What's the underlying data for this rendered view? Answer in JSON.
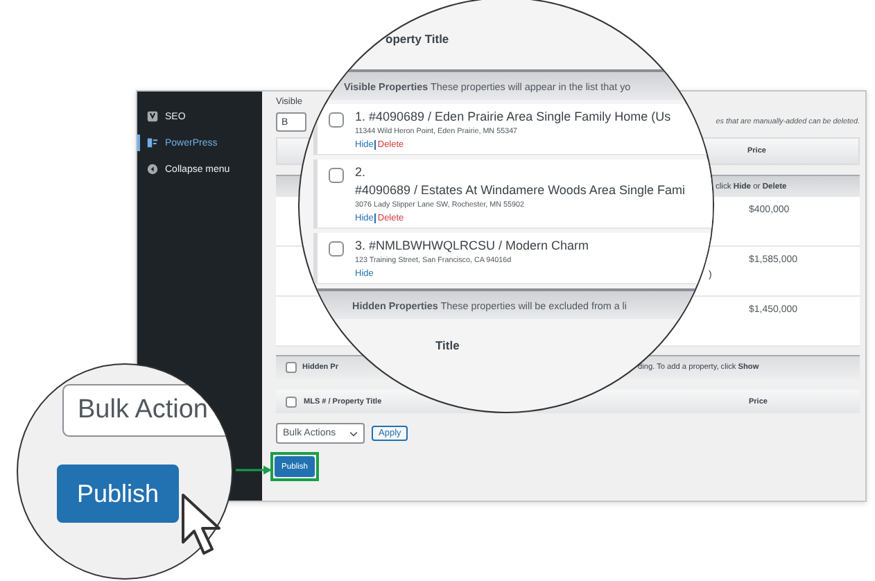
{
  "sidebar": {
    "items": [
      {
        "label": "SEO",
        "kind": "seo",
        "selected": false
      },
      {
        "label": "PowerPress",
        "kind": "podcast",
        "selected": true
      },
      {
        "label": "Collapse menu",
        "kind": "collapse",
        "selected": false
      }
    ]
  },
  "main": {
    "visible_label": "Visible",
    "bulk_select_top": "B",
    "notice": "es that are manually-added can be deleted.",
    "table_header": {
      "price": "Price"
    },
    "visible_section_tail": "click **Hide** or **Delete**",
    "rows": [
      {
        "price": "$400,000",
        "fragment": ""
      },
      {
        "price": "$1,585,000",
        "fragment": ")"
      },
      {
        "price": "$1,450,000",
        "fragment": ""
      }
    ],
    "hidden_section": {
      "checked": false,
      "head": "Hidden Pr",
      "tail": "ding. To add a property, click **Show**"
    },
    "footer_header": {
      "checked": false,
      "title": "MLS # / Property Title",
      "price": "Price"
    },
    "bulk_actions": {
      "value": "Bulk Actions",
      "apply": "Apply"
    },
    "publish": "Publish"
  },
  "magnifier": {
    "header": "operty Title",
    "visible_section": "**Visible Properties** These properties will appear in the list that yo",
    "properties": [
      {
        "number": "1.",
        "title": "#4090689 / Eden Prairie Area Single Family Home (Us",
        "wrapped": false,
        "address": "11344 Wild Heron Point, Eden Prairie, MN 55347",
        "checked": false,
        "actions": [
          {
            "label": "Hide",
            "kind": "hide"
          },
          {
            "label": "Delete",
            "kind": "delete"
          }
        ]
      },
      {
        "number": "2.",
        "title": "#4090689 / Estates At Windamere Woods Area Single Fami",
        "wrapped": true,
        "address": "3076 Lady Slipper Lane SW, Rochester, MN 55902",
        "checked": false,
        "actions": [
          {
            "label": "Hide",
            "kind": "hide"
          },
          {
            "label": "Delete",
            "kind": "delete"
          }
        ]
      },
      {
        "number": "3.",
        "title": "#NMLBWHWQLRCSU / Modern Charm",
        "wrapped": false,
        "address": "123 Training Street, San Francisco, CA 94016d",
        "checked": false,
        "actions": [
          {
            "label": "Hide",
            "kind": "hide"
          }
        ]
      }
    ],
    "hidden_section": "**Hidden Properties** These properties will be excluded from a li",
    "footer": "Title"
  },
  "callout": {
    "bulk_actions": "Bulk Action",
    "publish": "Publish"
  }
}
